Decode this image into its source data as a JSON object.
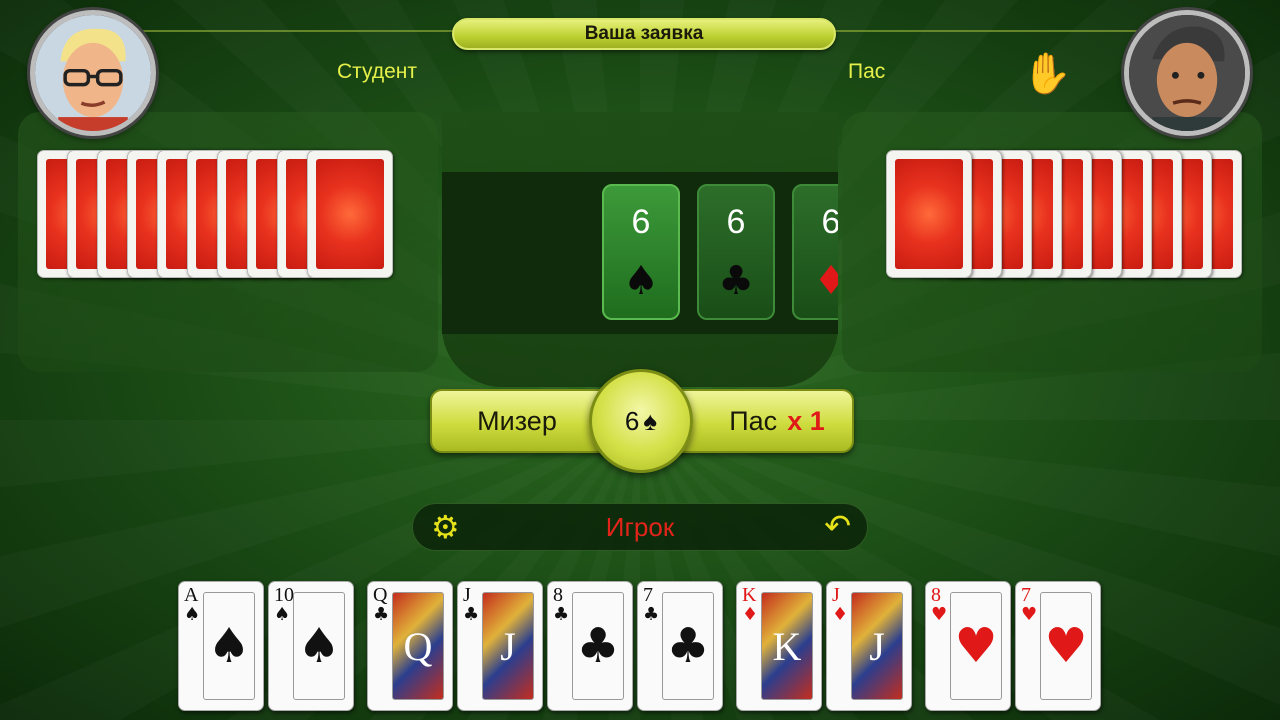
{
  "header": {
    "title": "Ваша заявка"
  },
  "players": {
    "left": {
      "name": "Студент"
    },
    "right": {
      "name": "Пас"
    }
  },
  "bids_strip": [
    {
      "number": "6",
      "suit": "♠"
    },
    {
      "number": "6",
      "suit": "♣"
    },
    {
      "number": "6",
      "suit": "♦"
    }
  ],
  "bid_bar": {
    "left_label": "Мизер",
    "center_number": "6",
    "center_suit": "♠",
    "right_label": "Пас",
    "right_multiplier": "x 1"
  },
  "status": {
    "text": "Игрок",
    "settings_icon": "gear-icon",
    "undo_icon": "undo-icon"
  },
  "hand": [
    {
      "rank": "A",
      "suit": "♠",
      "color": "black",
      "face": false
    },
    {
      "rank": "10",
      "suit": "♠",
      "color": "black",
      "face": false
    },
    {
      "rank": "Q",
      "suit": "♣",
      "color": "black",
      "face": true
    },
    {
      "rank": "J",
      "suit": "♣",
      "color": "black",
      "face": true
    },
    {
      "rank": "8",
      "suit": "♣",
      "color": "black",
      "face": false
    },
    {
      "rank": "7",
      "suit": "♣",
      "color": "black",
      "face": false
    },
    {
      "rank": "K",
      "suit": "♦",
      "color": "red",
      "face": true
    },
    {
      "rank": "J",
      "suit": "♦",
      "color": "red",
      "face": true
    },
    {
      "rank": "8",
      "suit": "♥",
      "color": "red",
      "face": false
    },
    {
      "rank": "7",
      "suit": "♥",
      "color": "red",
      "face": false
    }
  ],
  "colors": {
    "accent": "#cfdc3e",
    "title_text": "#e6f04a",
    "status_red": "#e3241a",
    "table": "#1f5418"
  }
}
